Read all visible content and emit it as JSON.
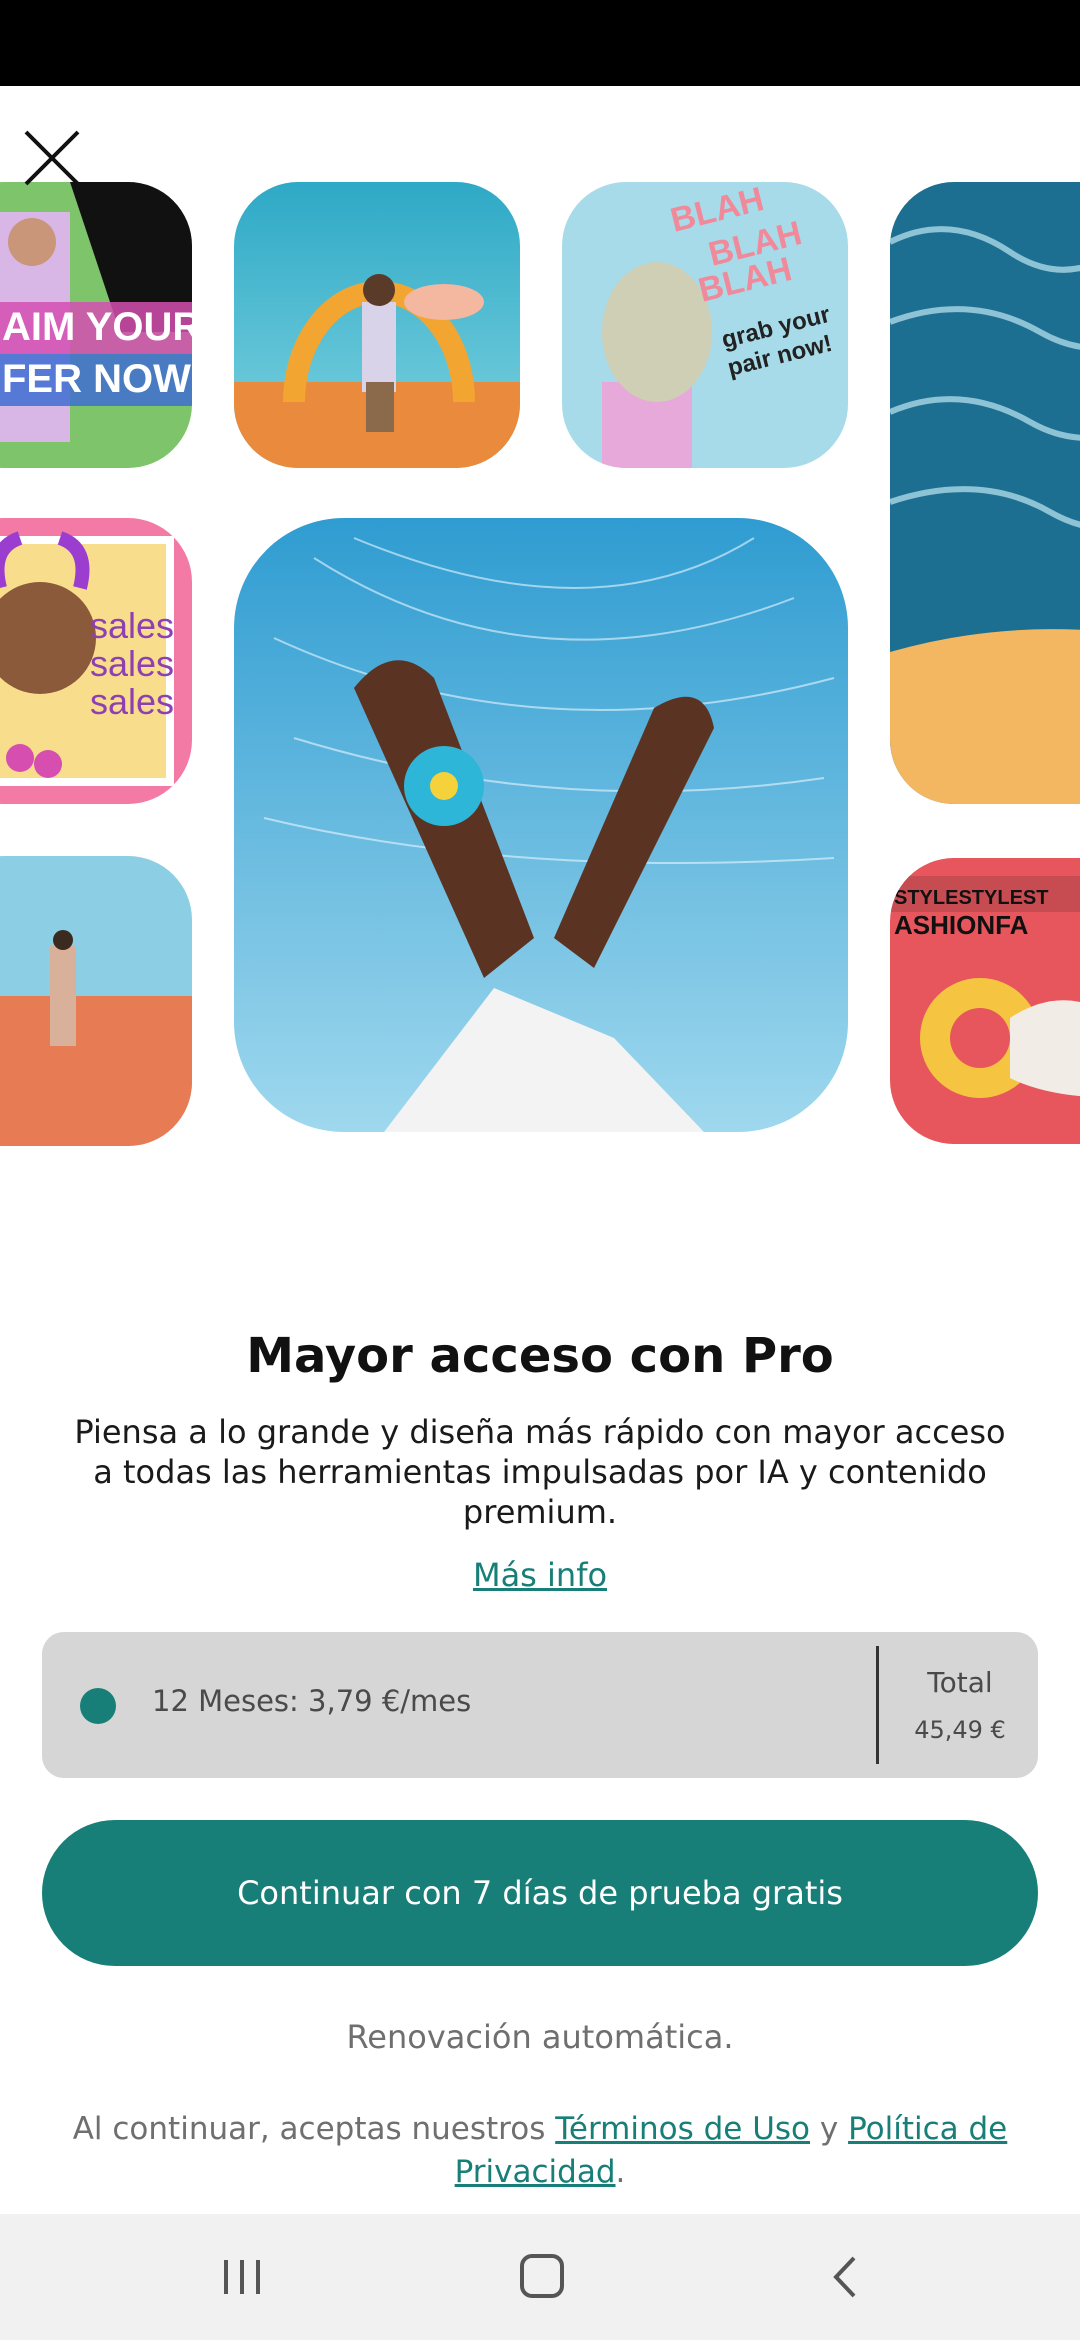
{
  "header": {
    "close_icon": "close-icon"
  },
  "gallery": {
    "tiles": [
      {
        "name": "promo-banner",
        "text_line1": "AIM YOUR",
        "text_line2": "FER NOW!"
      },
      {
        "name": "desert-arch",
        "text": ""
      },
      {
        "name": "sneakers",
        "text_line1": "BLAH",
        "text_line2": "BLAH",
        "text_line3": "BLAH",
        "text_line4": "grab your",
        "text_line5": "pair now!"
      },
      {
        "name": "ocean",
        "text": ""
      },
      {
        "name": "sales",
        "text_line1": "sales",
        "text_line2": "sales",
        "text_line3": "sales"
      },
      {
        "name": "hands-flower",
        "text": ""
      },
      {
        "name": "desert-walker",
        "text": ""
      },
      {
        "name": "fashion",
        "text_line1": "STYLESTYLEST",
        "text_line2": "ASHIONFA"
      }
    ]
  },
  "content": {
    "title": "Mayor acceso con Pro",
    "subtitle": "Piensa a lo grande y diseña más rápido con mayor acceso a todas las herramientas impulsadas por IA y contenido premium.",
    "more_info": "Más info"
  },
  "plan": {
    "label": "12 Meses: 3,79 €/mes",
    "total_label": "Total",
    "total_value": "45,49 €",
    "selected": true
  },
  "cta": {
    "label": "Continuar con 7 días de prueba gratis"
  },
  "renewal": "Renovación automática.",
  "legal": {
    "prefix": "Al continuar, aceptas nuestros ",
    "terms": "Términos de Uso",
    "connector": " y ",
    "privacy": "Política de Privacidad",
    "suffix": "."
  },
  "colors": {
    "accent": "#177f77",
    "card": "#d6d6d6",
    "muted": "#6f6f6f"
  },
  "nav": {
    "icons": [
      "recent-apps-icon",
      "home-icon",
      "back-icon"
    ]
  }
}
